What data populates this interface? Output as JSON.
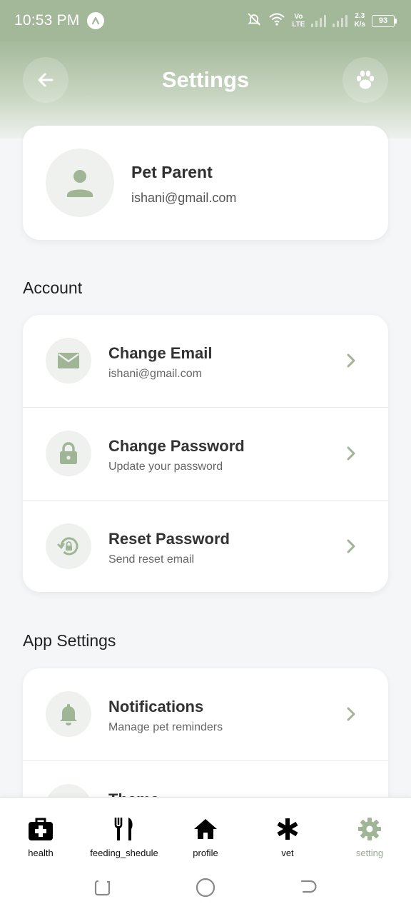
{
  "status_bar": {
    "time": "10:53 PM",
    "network_top": "Vo",
    "network_bottom": "LTE",
    "speed_top": "2.3",
    "speed_bottom": "K/s",
    "battery": "93"
  },
  "header": {
    "title": "Settings",
    "back_icon": "arrow-left-icon",
    "paw_icon": "paw-icon"
  },
  "profile": {
    "name": "Pet Parent",
    "email": "ishani@gmail.com"
  },
  "sections": {
    "account": {
      "title": "Account",
      "items": [
        {
          "icon": "mail-icon",
          "title": "Change Email",
          "subtitle": "ishani@gmail.com"
        },
        {
          "icon": "lock-icon",
          "title": "Change Password",
          "subtitle": "Update your password"
        },
        {
          "icon": "lock-reset-icon",
          "title": "Reset Password",
          "subtitle": "Send reset email"
        }
      ]
    },
    "app_settings": {
      "title": "App Settings",
      "items": [
        {
          "icon": "bell-icon",
          "title": "Notifications",
          "subtitle": "Manage pet reminders"
        },
        {
          "icon": "theme-icon",
          "title": "Theme",
          "subtitle": ""
        }
      ]
    }
  },
  "bottom_nav": {
    "items": [
      {
        "icon": "medical-kit-icon",
        "label": "health"
      },
      {
        "icon": "fork-knife-icon",
        "label": "feeding_shedule"
      },
      {
        "icon": "home-icon",
        "label": "profile"
      },
      {
        "icon": "asterisk-icon",
        "label": "vet"
      },
      {
        "icon": "gear-icon",
        "label": "setting",
        "active": true
      }
    ]
  },
  "colors": {
    "accent": "#a3b899",
    "icon_green": "#9fb596",
    "active_nav": "#9aa893"
  }
}
